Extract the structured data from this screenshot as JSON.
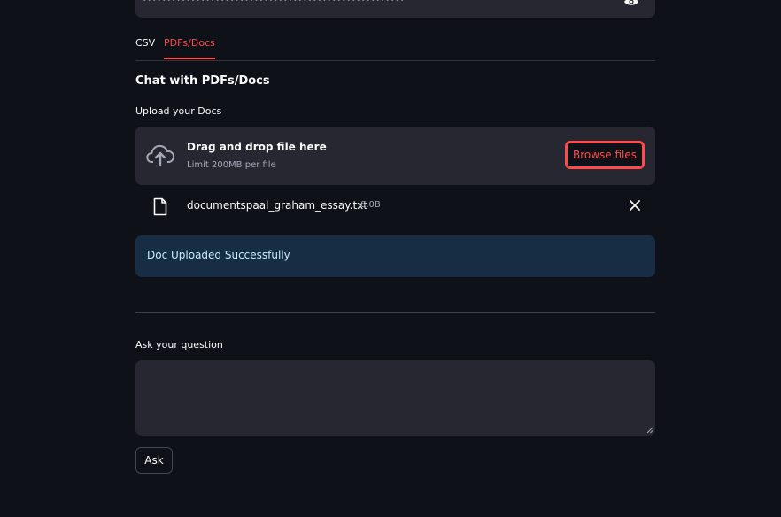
{
  "api_key_field": {
    "masked_value": "••••••••••••••••••••••••••••••••••••••••••••••••••••••"
  },
  "tabs": [
    {
      "label": "CSV",
      "active": false
    },
    {
      "label": "PDFs/Docs",
      "active": true
    }
  ],
  "section": {
    "subheader": "Chat with PDFs/Docs"
  },
  "uploader": {
    "label": "Upload your Docs",
    "drop_title": "Drag and drop file here",
    "limit_text": "Limit 200MB per file",
    "browse_label": "Browse files",
    "file": {
      "name": "documentspaal_graham_essay.txt",
      "size": "0.0B"
    }
  },
  "info": {
    "message": "Doc Uploaded Successfully"
  },
  "question": {
    "label": "Ask your question",
    "value": ""
  },
  "ask_button": {
    "label": "Ask"
  },
  "colors": {
    "background": "#0e1117",
    "accent": "#ff4b4b",
    "widget_bg": "#262730",
    "info_bg": "#172d43"
  },
  "icons": [
    "eye-icon",
    "cloud-upload-icon",
    "file-icon",
    "close-icon",
    "resize-grip-icon"
  ]
}
